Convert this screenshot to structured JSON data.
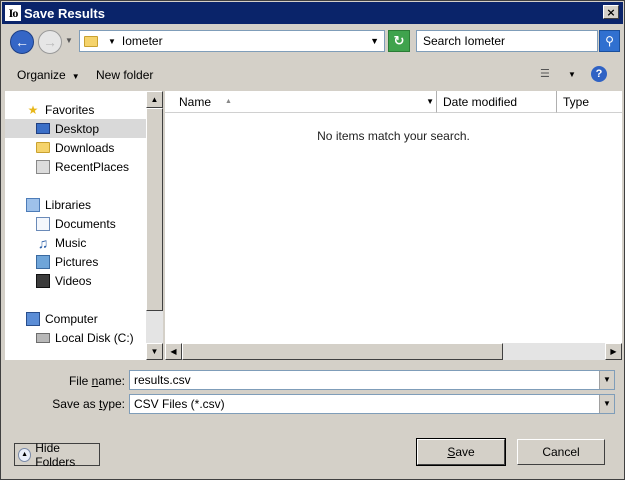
{
  "window": {
    "title": "Save Results",
    "app_icon_text": "Io",
    "close_glyph": "×"
  },
  "address": {
    "path": [
      "Iometer"
    ],
    "search_placeholder": "Search Iometer"
  },
  "toolbar": {
    "organize_label": "Organize",
    "new_folder_label": "New folder"
  },
  "nav": {
    "favorites": {
      "label": "Favorites",
      "items": [
        "Desktop",
        "Downloads",
        "RecentPlaces"
      ],
      "selected": "Desktop"
    },
    "libraries": {
      "label": "Libraries",
      "items": [
        "Documents",
        "Music",
        "Pictures",
        "Videos"
      ]
    },
    "computer": {
      "label": "Computer",
      "items": [
        "Local Disk (C:)"
      ]
    }
  },
  "file_list": {
    "columns": [
      "Name",
      "Date modified",
      "Type"
    ],
    "empty_message": "No items match your search."
  },
  "form": {
    "file_name_label_pre": "File ",
    "file_name_label_u": "n",
    "file_name_label_post": "ame:",
    "file_name_value": "results.csv",
    "save_type_label_pre": "Save as ",
    "save_type_label_u": "t",
    "save_type_label_post": "ype:",
    "save_type_value": "CSV Files (*.csv)"
  },
  "buttons": {
    "hide_folders": "Hide Folders",
    "save_u": "S",
    "save_rest": "ave",
    "cancel": "Cancel"
  },
  "colors": {
    "titlebar": "#0a246a",
    "dialog_bg": "#d4d0c8",
    "selection": "#d9d9d9"
  }
}
